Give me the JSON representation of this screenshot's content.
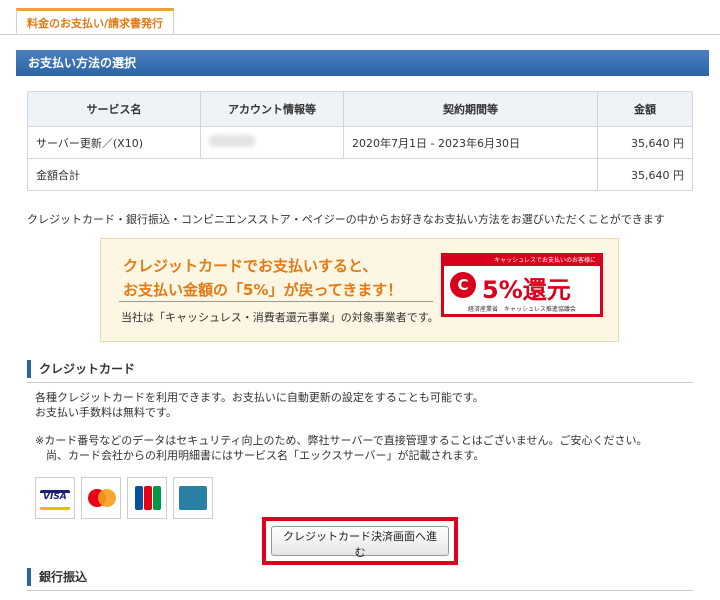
{
  "tab": {
    "label": "料金のお支払い/請求書発行"
  },
  "section": {
    "title": "お支払い方法の選択"
  },
  "table": {
    "headers": [
      "サービス名",
      "アカウント情報等",
      "契約期間等",
      "金額"
    ],
    "row": {
      "service": "サーバー更新／(X10)",
      "period": "2020年7月1日 - 2023年6月30日",
      "amount": "35,640 円"
    },
    "total_label": "金額合計",
    "total_amount": "35,640 円"
  },
  "description": "クレジットカード・銀行振込・コンビニエンスストア・ペイジーの中からお好きなお支払い方法をお選びいただくことができます",
  "promo": {
    "line1": "クレジットカードでお支払いすると、",
    "line2": "お支払い金額の「5%」が戻ってきます！",
    "note": "当社は「キャッシュレス・消費者還元事業」の対象事業者です。",
    "badge_top": "キャッシュレスでお支払いのお客様に",
    "badge_main": "5%還元",
    "badge_circle": "C",
    "badge_foot": "経済産業省　キャッシュレス推進協議会"
  },
  "credit": {
    "heading": "クレジットカード",
    "line1": "各種クレジットカードを利用できます。お支払いに自動更新の設定をすることも可能です。",
    "line2": "お支払い手数料は無料です。",
    "notice1": "※カード番号などのデータはセキュリティ向上のため、弊社サーバーで直接管理することはございません。ご安心ください。",
    "notice2": "尚、カード会社からの利用明細書にはサービス名「エックスサーバー」が記載されます。",
    "cards": [
      {
        "name": "VISA",
        "color": "#1a1f71"
      },
      {
        "name": "MasterCard",
        "color": "#eb001b"
      },
      {
        "name": "JCB",
        "color": "#0b4ea2"
      },
      {
        "name": "AMEX",
        "color": "#2a7fa5"
      }
    ],
    "button_label": "クレジットカード決済画面へ進む"
  },
  "bank": {
    "heading": "銀行振込"
  },
  "colors": {
    "accent": "#2c63a6",
    "highlight": "#e0001b",
    "tab": "#e27a16"
  }
}
